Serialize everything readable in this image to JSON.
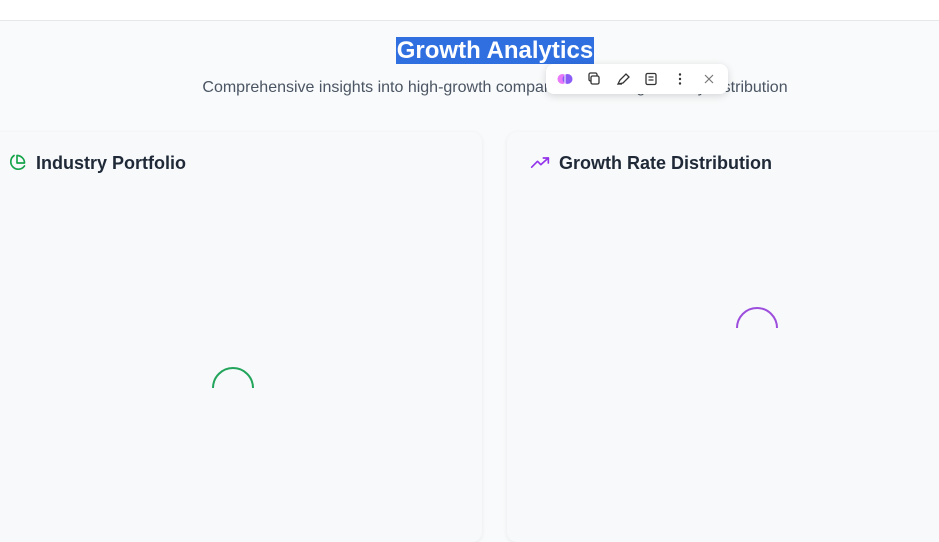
{
  "hero": {
    "title": "Growth Analytics",
    "subtitle": "Comprehensive insights into high-growth companies, including industry distribution"
  },
  "cards": {
    "industry": {
      "title": "Industry Portfolio",
      "icon": "pie-chart-icon",
      "accent": "#16a34a"
    },
    "growth": {
      "title": "Growth Rate Distribution",
      "icon": "trending-up-icon",
      "accent": "#9333ea"
    }
  },
  "toolbar": {
    "items": [
      "brain-icon",
      "copy-icon",
      "highlight-icon",
      "note-icon",
      "more-icon",
      "close-icon"
    ]
  }
}
